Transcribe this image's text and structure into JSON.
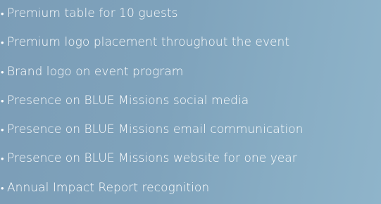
{
  "bullet": "•",
  "benefits": [
    "Premium table for 10 guests",
    "Premium logo placement throughout the event",
    "Brand logo on event program",
    "Presence on BLUE Missions social media",
    "Presence on BLUE Missions email communication",
    "Presence on BLUE Missions website for one year",
    "Annual Impact Report recognition"
  ]
}
